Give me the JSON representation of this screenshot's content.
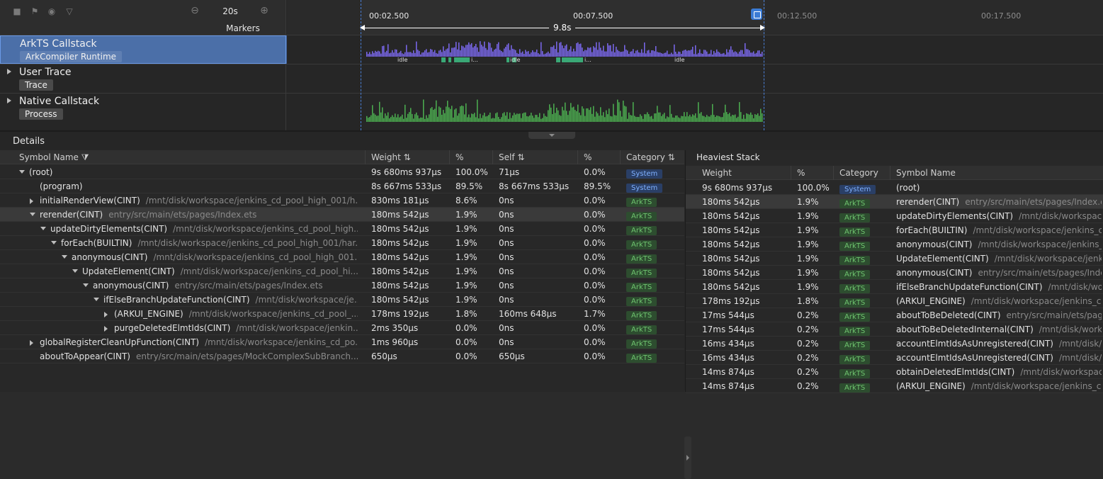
{
  "toolbar": {
    "zoom_value": "20s",
    "markers_label": "Markers",
    "icons": [
      "stop-icon",
      "flag-icon",
      "globe-icon",
      "filter-icon",
      "zoom-out-icon",
      "zoom-in-icon"
    ]
  },
  "ruler": {
    "ticks": [
      "00:02.500",
      "00:07.500",
      "00:12.500",
      "00:17.500"
    ],
    "range_text": "9.8s"
  },
  "lanes": [
    {
      "title": "ArkTS Callstack",
      "chip": "ArkCompiler Runtime",
      "selected": true,
      "idle_labels": [
        "idle",
        "i...",
        "idle",
        "i...",
        "idle"
      ]
    },
    {
      "title": "User Trace",
      "chip": "Trace",
      "selected": false
    },
    {
      "title": "Native Callstack",
      "chip": "Process",
      "selected": false
    }
  ],
  "details": {
    "title": "Details",
    "left_columns": [
      "Symbol Name",
      "Weight",
      "%",
      "Self",
      "%",
      "Category"
    ],
    "left_rows": [
      {
        "name": "(root)",
        "path": "",
        "weight": "9s 680ms 937µs",
        "pct": "100.0%",
        "self": "71µs",
        "self_pct": "0.0%",
        "cat": "System",
        "depth": 0,
        "toggle": "open"
      },
      {
        "name": "(program)",
        "path": "",
        "weight": "8s 667ms 533µs",
        "pct": "89.5%",
        "self": "8s 667ms 533µs",
        "self_pct": "89.5%",
        "cat": "System",
        "depth": 1,
        "toggle": "none"
      },
      {
        "name": "initialRenderView(CINT)",
        "path": "/mnt/disk/workspace/jenkins_cd_pool_high_001/h...",
        "weight": "830ms 181µs",
        "pct": "8.6%",
        "self": "0ns",
        "self_pct": "0.0%",
        "cat": "ArkTS",
        "depth": 1,
        "toggle": "closed"
      },
      {
        "name": "rerender(CINT)",
        "path": "entry/src/main/ets/pages/Index.ets",
        "weight": "180ms 542µs",
        "pct": "1.9%",
        "self": "0ns",
        "self_pct": "0.0%",
        "cat": "ArkTS",
        "depth": 1,
        "toggle": "open",
        "selected": true
      },
      {
        "name": "updateDirtyElements(CINT)",
        "path": "/mnt/disk/workspace/jenkins_cd_pool_high...",
        "weight": "180ms 542µs",
        "pct": "1.9%",
        "self": "0ns",
        "self_pct": "0.0%",
        "cat": "ArkTS",
        "depth": 2,
        "toggle": "open"
      },
      {
        "name": "forEach(BUILTIN)",
        "path": "/mnt/disk/workspace/jenkins_cd_pool_high_001/har...",
        "weight": "180ms 542µs",
        "pct": "1.9%",
        "self": "0ns",
        "self_pct": "0.0%",
        "cat": "ArkTS",
        "depth": 3,
        "toggle": "open"
      },
      {
        "name": "anonymous(CINT)",
        "path": "/mnt/disk/workspace/jenkins_cd_pool_high_001...",
        "weight": "180ms 542µs",
        "pct": "1.9%",
        "self": "0ns",
        "self_pct": "0.0%",
        "cat": "ArkTS",
        "depth": 4,
        "toggle": "open"
      },
      {
        "name": "UpdateElement(CINT)",
        "path": "/mnt/disk/workspace/jenkins_cd_pool_hi...",
        "weight": "180ms 542µs",
        "pct": "1.9%",
        "self": "0ns",
        "self_pct": "0.0%",
        "cat": "ArkTS",
        "depth": 5,
        "toggle": "open"
      },
      {
        "name": "anonymous(CINT)",
        "path": "entry/src/main/ets/pages/Index.ets",
        "weight": "180ms 542µs",
        "pct": "1.9%",
        "self": "0ns",
        "self_pct": "0.0%",
        "cat": "ArkTS",
        "depth": 6,
        "toggle": "open"
      },
      {
        "name": "ifElseBranchUpdateFunction(CINT)",
        "path": "/mnt/disk/workspace/je...",
        "weight": "180ms 542µs",
        "pct": "1.9%",
        "self": "0ns",
        "self_pct": "0.0%",
        "cat": "ArkTS",
        "depth": 7,
        "toggle": "open"
      },
      {
        "name": "(ARKUI_ENGINE)",
        "path": "/mnt/disk/workspace/jenkins_cd_pool_...",
        "weight": "178ms 192µs",
        "pct": "1.8%",
        "self": "160ms 648µs",
        "self_pct": "1.7%",
        "cat": "ArkTS",
        "depth": 8,
        "toggle": "closed"
      },
      {
        "name": "purgeDeletedElmtIds(CINT)",
        "path": "/mnt/disk/workspace/jenkin...",
        "weight": "2ms 350µs",
        "pct": "0.0%",
        "self": "0ns",
        "self_pct": "0.0%",
        "cat": "ArkTS",
        "depth": 8,
        "toggle": "closed"
      },
      {
        "name": "globalRegisterCleanUpFunction(CINT)",
        "path": "/mnt/disk/workspace/jenkins_cd_po...",
        "weight": "1ms 960µs",
        "pct": "0.0%",
        "self": "0ns",
        "self_pct": "0.0%",
        "cat": "ArkTS",
        "depth": 1,
        "toggle": "closed"
      },
      {
        "name": "aboutToAppear(CINT)",
        "path": "entry/src/main/ets/pages/MockComplexSubBranch....",
        "weight": "650µs",
        "pct": "0.0%",
        "self": "650µs",
        "self_pct": "0.0%",
        "cat": "ArkTS",
        "depth": 1,
        "toggle": "none"
      }
    ],
    "heaviest_title": "Heaviest Stack",
    "right_columns": [
      "Weight",
      "%",
      "Category",
      "Symbol Name"
    ],
    "right_rows": [
      {
        "weight": "9s 680ms 937µs",
        "pct": "100.0%",
        "cat": "System",
        "name": "(root)",
        "path": ""
      },
      {
        "weight": "180ms 542µs",
        "pct": "1.9%",
        "cat": "ArkTS",
        "name": "rerender(CINT)",
        "path": "entry/src/main/ets/pages/Index.e",
        "selected": true
      },
      {
        "weight": "180ms 542µs",
        "pct": "1.9%",
        "cat": "ArkTS",
        "name": "updateDirtyElements(CINT)",
        "path": "/mnt/disk/workspace"
      },
      {
        "weight": "180ms 542µs",
        "pct": "1.9%",
        "cat": "ArkTS",
        "name": "forEach(BUILTIN)",
        "path": "/mnt/disk/workspace/jenkins_c"
      },
      {
        "weight": "180ms 542µs",
        "pct": "1.9%",
        "cat": "ArkTS",
        "name": "anonymous(CINT)",
        "path": "/mnt/disk/workspace/jenkins_"
      },
      {
        "weight": "180ms 542µs",
        "pct": "1.9%",
        "cat": "ArkTS",
        "name": "UpdateElement(CINT)",
        "path": "/mnt/disk/workspace/jenk"
      },
      {
        "weight": "180ms 542µs",
        "pct": "1.9%",
        "cat": "ArkTS",
        "name": "anonymous(CINT)",
        "path": "entry/src/main/ets/pages/Inde"
      },
      {
        "weight": "180ms 542µs",
        "pct": "1.9%",
        "cat": "ArkTS",
        "name": "ifElseBranchUpdateFunction(CINT)",
        "path": "/mnt/disk/work"
      },
      {
        "weight": "178ms 192µs",
        "pct": "1.8%",
        "cat": "ArkTS",
        "name": "(ARKUI_ENGINE)",
        "path": "/mnt/disk/workspace/jenkins_co"
      },
      {
        "weight": "17ms 544µs",
        "pct": "0.2%",
        "cat": "ArkTS",
        "name": "aboutToBeDeleted(CINT)",
        "path": "entry/src/main/ets/pag"
      },
      {
        "weight": "17ms 544µs",
        "pct": "0.2%",
        "cat": "ArkTS",
        "name": "aboutToBeDeletedInternal(CINT)",
        "path": "/mnt/disk/work"
      },
      {
        "weight": "16ms 434µs",
        "pct": "0.2%",
        "cat": "ArkTS",
        "name": "accountElmtIdsAsUnregistered(CINT)",
        "path": "/mnt/disk/w"
      },
      {
        "weight": "16ms 434µs",
        "pct": "0.2%",
        "cat": "ArkTS",
        "name": "accountElmtIdsAsUnregistered(CINT)",
        "path": "/mnt/disk/v"
      },
      {
        "weight": "14ms 874µs",
        "pct": "0.2%",
        "cat": "ArkTS",
        "name": "obtainDeletedElmtIds(CINT)",
        "path": "/mnt/disk/workspac"
      },
      {
        "weight": "14ms 874µs",
        "pct": "0.2%",
        "cat": "ArkTS",
        "name": "(ARKUI_ENGINE)",
        "path": "/mnt/disk/workspace/jenkins_co"
      }
    ]
  },
  "colors": {
    "arkts_graph": "#7b68ee",
    "native_graph": "#4caf50",
    "idle_bar": "#3aa876",
    "selection": "#4a7fd6"
  }
}
